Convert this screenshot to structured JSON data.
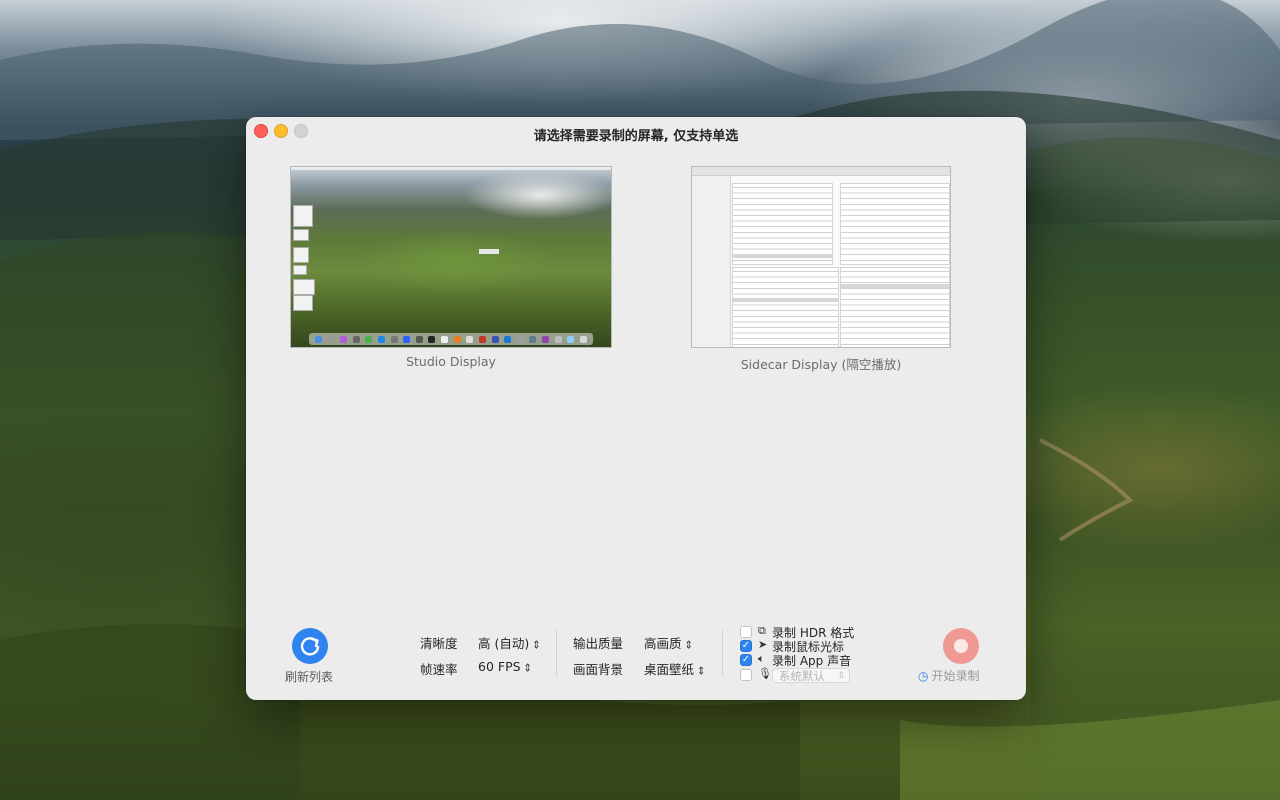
{
  "window": {
    "title": "请选择需要录制的屏幕, 仅支持单选"
  },
  "displays": [
    {
      "name": "Studio Display"
    },
    {
      "name": "Sidecar Display (隔空播放)"
    }
  ],
  "refresh": {
    "label": "刷新列表",
    "icon": "refresh-icon"
  },
  "options": {
    "resolution": {
      "label": "清晰度",
      "value": "高 (自动)"
    },
    "framerate": {
      "label": "帧速率",
      "value": "60 FPS"
    },
    "quality": {
      "label": "输出质量",
      "value": "高画质"
    },
    "background": {
      "label": "画面背景",
      "value": "桌面壁纸"
    }
  },
  "checkboxes": [
    {
      "label": "录制 HDR 格式",
      "checked": false,
      "icon": "hdr-icon"
    },
    {
      "label": "录制鼠标光标",
      "checked": true,
      "icon": "cursor-icon"
    },
    {
      "label": "录制 App 声音",
      "checked": true,
      "icon": "speaker-icon"
    },
    {
      "label": "",
      "checked": false,
      "icon": "microphone-icon"
    }
  ],
  "mic": {
    "value": "系统默认"
  },
  "record": {
    "label": "开始录制",
    "icon": "timer-icon"
  },
  "colors": {
    "accent": "#2f83ef",
    "record": "#ee9a93",
    "close": "#ff5f57",
    "minimize": "#febc2e"
  }
}
